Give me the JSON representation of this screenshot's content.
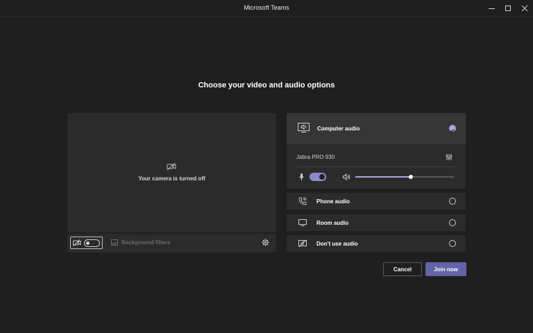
{
  "window": {
    "title": "Microsoft Teams",
    "controls": [
      "minimize-icon",
      "maximize-icon",
      "close-icon"
    ]
  },
  "heading": "Choose your video and audio options",
  "video": {
    "camera_status": "Your camera is turned off",
    "camera_toggle_on": false,
    "background_filters_label": "Background filters"
  },
  "audio": {
    "computer_audio": {
      "label": "Computer audio",
      "selected": true,
      "device": "Jabra PRO 930",
      "mic_on": true,
      "volume_percent": 56
    },
    "options": [
      {
        "label": "Phone audio",
        "icon": "phone-icon",
        "selected": false
      },
      {
        "label": "Room audio",
        "icon": "monitor-icon",
        "selected": false
      },
      {
        "label": "Don't use audio",
        "icon": "no-audio-icon",
        "selected": false
      }
    ]
  },
  "buttons": {
    "cancel": "Cancel",
    "join": "Join now"
  },
  "colors": {
    "background": "#1f1f1f",
    "panel": "#2b2b2b",
    "accent": "#6264a7",
    "accent_light": "#a6a7dc"
  }
}
